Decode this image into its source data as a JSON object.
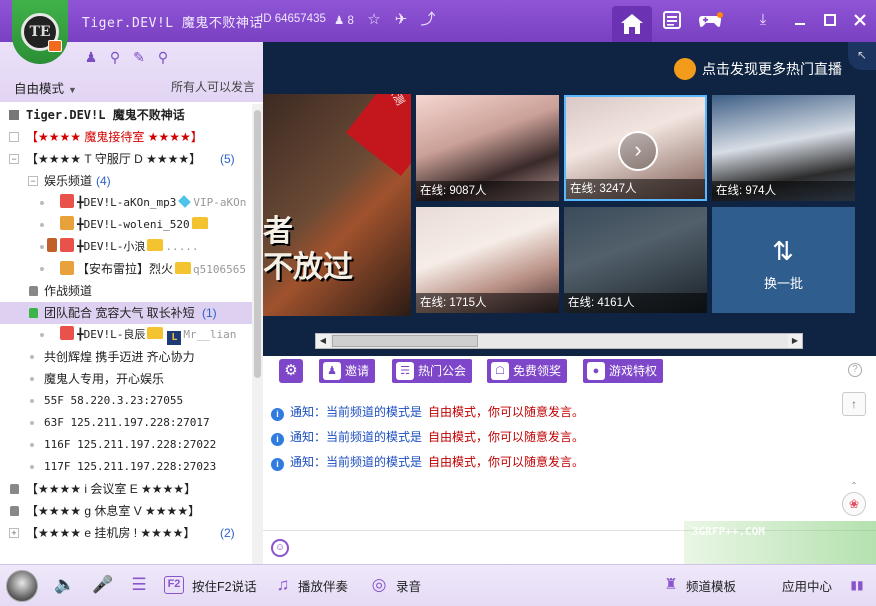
{
  "header": {
    "channel_name": "Tiger.DEV!L 魔鬼不败神话",
    "channel_id": "ID 64657435",
    "online_count": "8",
    "logo_text": "TE"
  },
  "left": {
    "mode": "自由模式",
    "speak_policy": "所有人可以发言",
    "tree": [
      {
        "text": "Tiger.DEV!L 魔鬼不败神话"
      },
      {
        "text": "【★★★★ 魔鬼接待室 ★★★★】"
      },
      {
        "text": "【★★★★ T 守服厅 D ★★★★】",
        "count": "(5)"
      },
      {
        "text": "娱乐频道",
        "count": "(4)"
      },
      {
        "text": "╋DEV!L-aKOn_mp3",
        "extra": "VIP-aKOn"
      },
      {
        "text": "╋DEV!L-woleni_520"
      },
      {
        "text": "╋DEV!L-小浪",
        "extra": "....."
      },
      {
        "text": "【安布雷拉】烈火",
        "extra": "q5106565"
      },
      {
        "text": "作战频道"
      },
      {
        "text": "团队配合 宽容大气 取长补短",
        "count": "(1)"
      },
      {
        "text": "╋DEV!L-良辰",
        "extra": "Mr__lian"
      },
      {
        "text": "共创辉煌 携手迈进 齐心协力"
      },
      {
        "text": "魔鬼人专用，开心娱乐"
      },
      {
        "text": "55F 58.220.3.23:27055"
      },
      {
        "text": "63F 125.211.197.228:27017"
      },
      {
        "text": "116F 125.211.197.228:27022"
      },
      {
        "text": "117F 125.211.197.228:27023"
      },
      {
        "text": "【★★★★ i 会议室 E ★★★★】"
      },
      {
        "text": "【★★★★ g 休息室 V ★★★★】"
      },
      {
        "text": "【★★★★ e 挂机房 ! ★★★★】",
        "count": "(2)"
      }
    ]
  },
  "video": {
    "discover_label": "点击发现更多热门直播",
    "poster_ribbon": "13号10:00 公测",
    "poster_text": "者\n不放过",
    "tiles": [
      {
        "caption": "在线: 9087人"
      },
      {
        "caption": "在线: 3247人"
      },
      {
        "caption": "在线: 974人"
      },
      {
        "caption": "在线: 1715人"
      },
      {
        "caption": "在线: 4161人"
      }
    ],
    "swap_label": "换一批"
  },
  "toolbar": {
    "invite": "邀请",
    "hot_guild": "热门公会",
    "free_claim": "免费领奖",
    "game_perks": "游戏特权"
  },
  "chat": {
    "notices": [
      {
        "prefix": "通知：",
        "body": "当前频道的模式是",
        "mode": "自由模式",
        "suffix": "，你可以随意发言。"
      },
      {
        "prefix": "通知：",
        "body": "当前频道的模式是",
        "mode": "自由模式",
        "suffix": "，你可以随意发言。"
      },
      {
        "prefix": "通知：",
        "body": "当前频道的模式是",
        "mode": "自由模式",
        "suffix": "，你可以随意发言。"
      }
    ]
  },
  "bottom": {
    "push_to_talk": "按住F2说话",
    "play_music": "播放伴奏",
    "record": "录音",
    "channel_template": "频道模板",
    "app_center": "应用中心",
    "f2_key": "F2"
  },
  "watermark": "3GRFP++.COM"
}
